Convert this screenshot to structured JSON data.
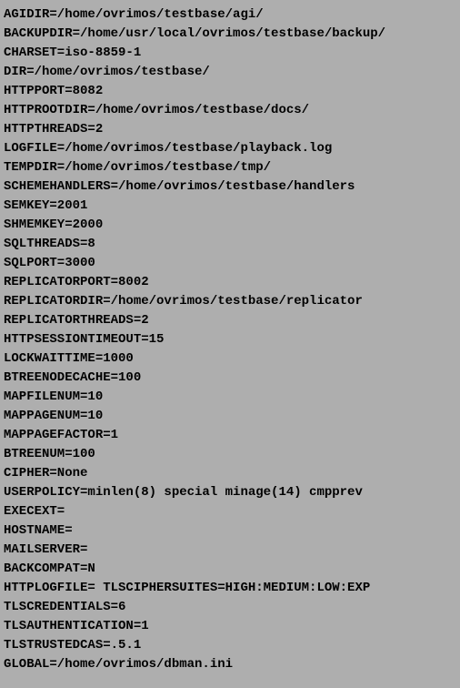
{
  "lines": [
    "AGIDIR=/home/ovrimos/testbase/agi/",
    "BACKUPDIR=/home/usr/local/ovrimos/testbase/backup/",
    "CHARSET=iso-8859-1",
    "DIR=/home/ovrimos/testbase/",
    "HTTPPORT=8082",
    "HTTPROOTDIR=/home/ovrimos/testbase/docs/",
    "HTTPTHREADS=2",
    "LOGFILE=/home/ovrimos/testbase/playback.log",
    "TEMPDIR=/home/ovrimos/testbase/tmp/",
    "SCHEMEHANDLERS=/home/ovrimos/testbase/handlers",
    "SEMKEY=2001",
    "SHMEMKEY=2000",
    "SQLTHREADS=8",
    "SQLPORT=3000",
    "REPLICATORPORT=8002",
    "REPLICATORDIR=/home/ovrimos/testbase/replicator",
    "REPLICATORTHREADS=2",
    "HTTPSESSIONTIMEOUT=15",
    "LOCKWAITTIME=1000",
    "BTREENODECACHE=100",
    "MAPFILENUM=10",
    "MAPPAGENUM=10",
    "MAPPAGEFACTOR=1",
    "BTREENUM=100",
    "CIPHER=None",
    "USERPOLICY=minlen(8) special minage(14) cmpprev",
    "EXECEXT=",
    "HOSTNAME=",
    "MAILSERVER=",
    "BACKCOMPAT=N",
    "HTTPLOGFILE= TLSCIPHERSUITES=HIGH:MEDIUM:LOW:EXP",
    "TLSCREDENTIALS=6",
    "TLSAUTHENTICATION=1",
    "TLSTRUSTEDCAS=.5.1",
    "GLOBAL=/home/ovrimos/dbman.ini"
  ]
}
